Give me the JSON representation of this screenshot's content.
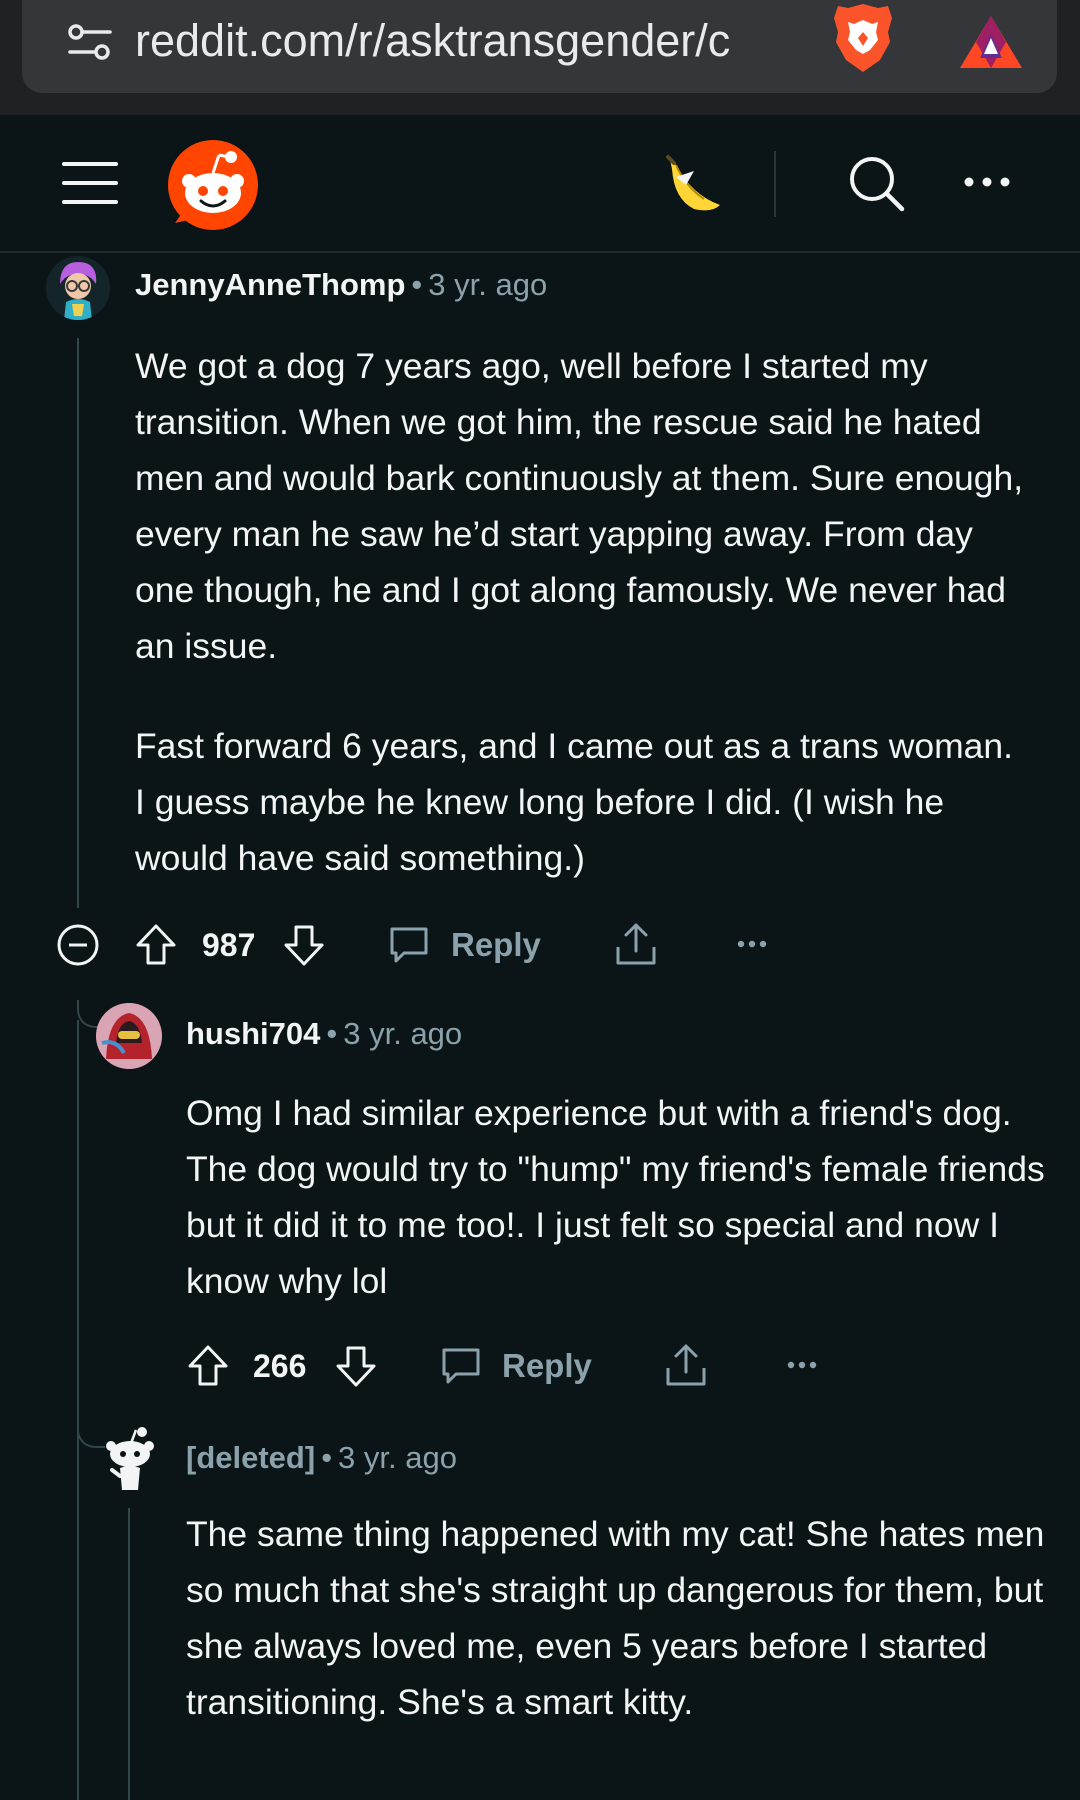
{
  "browser": {
    "url": "reddit.com/r/asktransgender/c"
  },
  "header": {
    "menu_icon": "hamburger-menu-icon",
    "logo": "reddit-snoo-logo",
    "banana_icon": "banana-icon",
    "search_icon": "search-icon",
    "more_icon": "more-options-icon"
  },
  "comments": [
    {
      "author": "JennyAnneThomp",
      "separator": "•",
      "time": "3 yr. ago",
      "paragraphs": [
        "We got a dog 7 years ago, well before I started my transition. When we got him, the rescue said he hated men and would bark continuously at them. Sure enough, every man he saw he’d start yapping away. From day one though, he and I got along famously. We never had an issue.",
        "Fast forward 6 years, and I came out as a trans woman. I guess maybe he knew long before I did. (I wish he would have said something.)"
      ],
      "score": "987",
      "reply_label": "Reply"
    },
    {
      "author": "hushi704",
      "separator": "•",
      "time": "3 yr. ago",
      "paragraphs": [
        "Omg I had similar experience but with a friend's dog. The dog would try to \"hump\" my friend's female friends but it did it to me too!. I just felt so special and now I know why lol"
      ],
      "score": "266",
      "reply_label": "Reply"
    },
    {
      "author": "[deleted]",
      "separator": "•",
      "time": "3 yr. ago",
      "paragraphs": [
        "The same thing happened with my cat! She hates men so much that she's straight up dangerous for them, but she always loved me, even 5 years before I started transitioning. She's a smart kitty."
      ]
    }
  ],
  "colors": {
    "background": "#0b1416",
    "text": "#f2f4f5",
    "muted": "#8ba2ad",
    "reddit_orange": "#ff4500",
    "thread_line": "#33464c"
  }
}
